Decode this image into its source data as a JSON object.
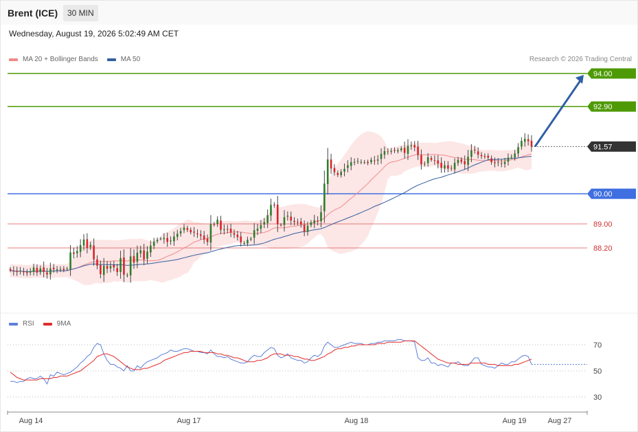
{
  "header": {
    "title": "Brent (ICE)",
    "interval": "30 MIN",
    "datetime": "Wednesday, August 19, 2026 5:02:49 AM CET",
    "credit": "Research © 2026 Trading Central"
  },
  "legend_main": [
    {
      "label": "MA 20 + Bollinger Bands",
      "color": "#f08a8a"
    },
    {
      "label": "MA 50",
      "color": "#345f9e"
    }
  ],
  "legend_rsi": [
    {
      "label": "RSI",
      "color": "#5b7fd9"
    },
    {
      "label": "9MA",
      "color": "#e22b2b"
    }
  ],
  "colors": {
    "up_candle": "#2f7d2b",
    "down_candle": "#d9242a",
    "resistance": "#4e9a06",
    "support": "#3f6fe0",
    "minor_level": "#e06666",
    "current_price": "#333333",
    "arrow": "#2f5fa6",
    "band_fill": "#fde2e2",
    "ma20": "#f08a8a",
    "ma50": "#345f9e"
  },
  "chart_data": [
    {
      "type": "candlestick",
      "x_labels": [
        "Aug 14",
        "Aug 17",
        "Aug 18",
        "Aug 19",
        "Aug 27"
      ],
      "ylim": [
        86.5,
        94.3
      ],
      "price_levels": [
        {
          "value": 94.0,
          "label": "94.00",
          "kind": "resistance"
        },
        {
          "value": 92.9,
          "label": "92.90",
          "kind": "resistance"
        },
        {
          "value": 91.57,
          "label": "91.57",
          "kind": "current"
        },
        {
          "value": 90.0,
          "label": "90.00",
          "kind": "support"
        },
        {
          "value": 89.0,
          "label": "89.00",
          "kind": "minor"
        },
        {
          "value": 88.2,
          "label": "88.20",
          "kind": "minor"
        }
      ],
      "current_price": 91.57,
      "target": 94.0,
      "closes": [
        87.45,
        87.42,
        87.4,
        87.44,
        87.39,
        87.36,
        87.43,
        87.55,
        87.38,
        87.52,
        87.4,
        87.32,
        87.52,
        87.49,
        87.49,
        87.5,
        87.47,
        87.51,
        88.05,
        88.0,
        88.1,
        88.29,
        88.48,
        88.2,
        88.3,
        87.82,
        87.61,
        87.33,
        87.61,
        87.51,
        87.6,
        87.55,
        87.4,
        87.86,
        87.31,
        87.3,
        87.92,
        87.71,
        88.04,
        88.12,
        87.82,
        88.08,
        88.28,
        88.41,
        88.47,
        88.51,
        88.53,
        88.4,
        88.45,
        88.58,
        88.67,
        88.76,
        88.88,
        88.8,
        88.72,
        88.71,
        88.66,
        88.6,
        88.48,
        88.4,
        88.99,
        88.98,
        89.14,
        88.8,
        88.82,
        88.81,
        88.71,
        88.64,
        88.56,
        88.39,
        88.36,
        88.47,
        88.51,
        88.79,
        88.84,
        88.96,
        89.06,
        89.29,
        89.63,
        89.61,
        88.99,
        88.96,
        89.22,
        89.27,
        89.11,
        89.06,
        89.05,
        88.98,
        88.73,
        88.94,
        89.05,
        89.12,
        89.08,
        89.39,
        90.34,
        91.14,
        90.84,
        90.72,
        90.63,
        90.73,
        90.83,
        90.95,
        91.05,
        91.06,
        91.09,
        91.06,
        91.05,
        91.02,
        91.13,
        91.1,
        91.14,
        91.33,
        91.42,
        91.39,
        91.43,
        91.43,
        91.45,
        91.51,
        91.36,
        91.59,
        91.61,
        91.54,
        91.3,
        90.98,
        91.0,
        91.22,
        91.13,
        91.1,
        91.0,
        90.86,
        90.95,
        90.84,
        90.84,
        91.03,
        91.13,
        91.06,
        90.98,
        91.23,
        91.45,
        91.44,
        91.3,
        91.25,
        91.23,
        91.2,
        91.05,
        91.02,
        91.05,
        91.0,
        91.06,
        91.2,
        91.23,
        91.34,
        91.55,
        91.76,
        91.83,
        91.75,
        91.57
      ]
    },
    {
      "type": "line",
      "title": "RSI",
      "ylim": [
        20,
        80
      ],
      "ticks": [
        70,
        50,
        30
      ],
      "series": [
        {
          "name": "RSI",
          "values": [
            42,
            42,
            41,
            42,
            42,
            44,
            45,
            44,
            44,
            46,
            44,
            40,
            47,
            46,
            49,
            48,
            47,
            48,
            49,
            51,
            53,
            56,
            58,
            61,
            63,
            68,
            71,
            70,
            63,
            58,
            55,
            55,
            53,
            52,
            50,
            54,
            50,
            50,
            54,
            52,
            55,
            57,
            58,
            59,
            60,
            62,
            63,
            64,
            66,
            65,
            65,
            66,
            67,
            67,
            66,
            65,
            65,
            64,
            64,
            63,
            66,
            63,
            61,
            61,
            60,
            61,
            59,
            58,
            57,
            56,
            56,
            57,
            60,
            62,
            61,
            61,
            64,
            66,
            68,
            67,
            62,
            60,
            61,
            63,
            60,
            59,
            58,
            58,
            56,
            57,
            60,
            62,
            61,
            63,
            69,
            72,
            70,
            68,
            68,
            69,
            70,
            71,
            72,
            71,
            71,
            71,
            70,
            70,
            71,
            71,
            72,
            72,
            73,
            73,
            73,
            73,
            74,
            74,
            73,
            73,
            73,
            72,
            60,
            58,
            58,
            60,
            56,
            56,
            54,
            55,
            54,
            53,
            56,
            56,
            57,
            55,
            54,
            54,
            57,
            60,
            60,
            55,
            54,
            53,
            53,
            52,
            54,
            56,
            55,
            55,
            57,
            57,
            59,
            61,
            62,
            61,
            55
          ]
        },
        {
          "name": "9MA",
          "values": [
            49,
            47,
            45,
            44,
            43,
            43,
            43,
            43,
            43,
            44,
            44,
            44,
            44,
            45,
            45,
            46,
            46,
            46,
            47,
            48,
            49,
            50,
            52,
            54,
            56,
            58,
            61,
            62,
            63,
            63,
            62,
            61,
            59,
            57,
            55,
            53,
            52,
            51,
            51,
            51,
            52,
            52,
            53,
            54,
            55,
            56,
            58,
            59,
            60,
            61,
            62,
            63,
            64,
            64,
            65,
            65,
            65,
            65,
            64,
            64,
            64,
            64,
            63,
            63,
            62,
            62,
            61,
            60,
            60,
            59,
            58,
            57,
            57,
            57,
            58,
            58,
            59,
            60,
            62,
            63,
            63,
            63,
            62,
            62,
            62,
            61,
            61,
            60,
            59,
            59,
            58,
            58,
            59,
            60,
            61,
            63,
            64,
            66,
            67,
            67,
            68,
            68,
            69,
            69,
            70,
            70,
            70,
            70,
            70,
            70,
            71,
            71,
            71,
            72,
            72,
            72,
            72,
            72,
            73,
            73,
            73,
            73,
            71,
            69,
            67,
            65,
            63,
            61,
            59,
            58,
            57,
            56,
            56,
            56,
            55,
            55,
            55,
            55,
            56,
            56,
            56,
            56,
            56,
            55,
            55,
            55,
            54,
            54,
            54,
            54,
            54,
            55,
            55,
            56,
            57,
            58,
            59
          ]
        }
      ]
    }
  ]
}
